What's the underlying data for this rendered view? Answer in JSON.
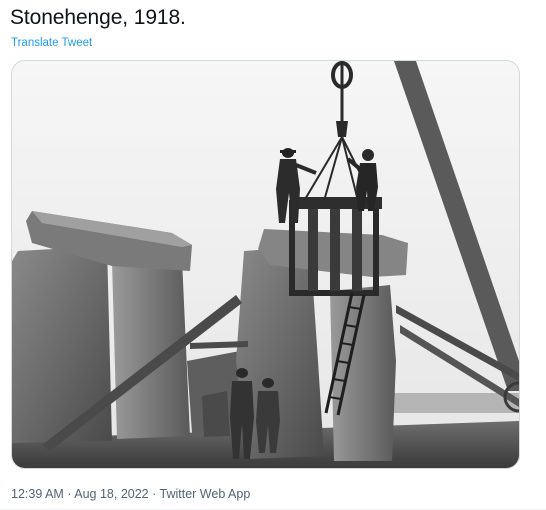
{
  "tweet": {
    "text": "Stonehenge, 1918.",
    "translate_label": "Translate Tweet"
  },
  "media": {
    "description_icon": "photo",
    "tone": "black-and-white"
  },
  "meta": {
    "time": "12:39 AM",
    "separator_1": " · ",
    "date": "Aug 18, 2022",
    "separator_2": " · ",
    "source": "Twitter Web App"
  },
  "colors": {
    "text": "#0f1419",
    "link": "#1d9bf0",
    "secondary": "#536471",
    "border": "#cfd9de"
  }
}
